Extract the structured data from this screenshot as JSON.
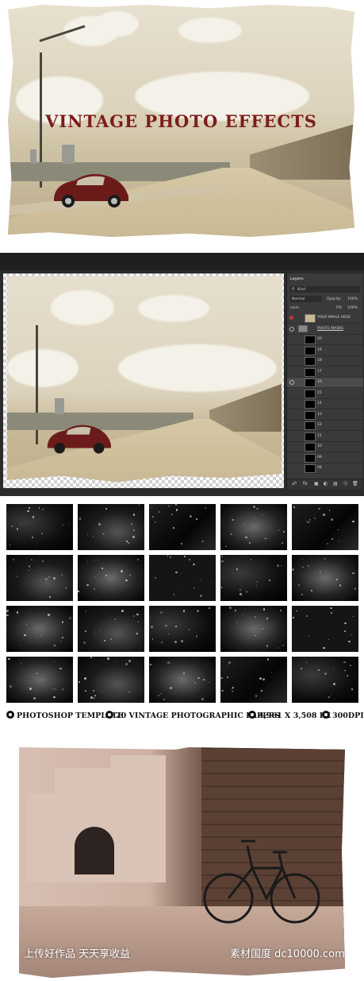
{
  "hero": {
    "title": "VINTAGE PHOTO EFFECTS"
  },
  "photoshop": {
    "panel_tab": "Layers",
    "kind_label": "Kind",
    "blend_mode": "Normal",
    "opacity_label": "Opacity:",
    "opacity_value": "100%",
    "lock_label": "Lock:",
    "fill_label": "Fill:",
    "fill_value": "100%",
    "layers": [
      {
        "name": "YOUR IMAGE HERE"
      },
      {
        "name": "PHOTO MASKS"
      },
      {
        "name": "20"
      },
      {
        "name": "19"
      },
      {
        "name": "18"
      },
      {
        "name": "17"
      },
      {
        "name": "16"
      },
      {
        "name": "15"
      },
      {
        "name": "14"
      },
      {
        "name": "13"
      },
      {
        "name": "12"
      },
      {
        "name": "11"
      },
      {
        "name": "10"
      },
      {
        "name": "09"
      },
      {
        "name": "08"
      }
    ],
    "accent_color": "#c0392b"
  },
  "features": [
    {
      "icon": "psd-icon",
      "label": "PHOTOSHOP TEMPLATE"
    },
    {
      "icon": "paper-icon",
      "label": "20 VINTAGE PHOTOGRAPHIC PAPERS"
    },
    {
      "icon": "size-icon",
      "label": "4,961 X 3,508 PX"
    },
    {
      "icon": "dpi-icon",
      "label": "300DPI"
    }
  ],
  "watermark": {
    "left": "上传好作品 天天享收益",
    "right": "素材国度 dc10000.com"
  }
}
